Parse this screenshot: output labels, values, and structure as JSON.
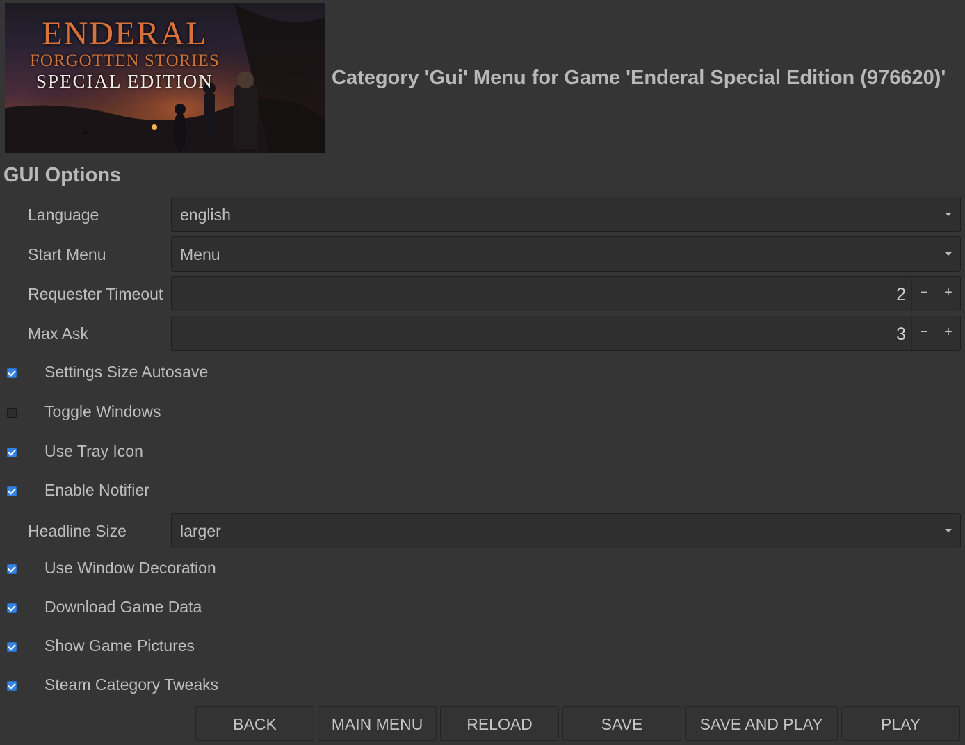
{
  "header": {
    "banner": {
      "title_line1": "ENDERAL",
      "title_line2": "FORGOTTEN STORIES",
      "title_line3": "SPECIAL EDITION"
    },
    "title": "Category 'Gui' Menu for Game 'Enderal Special Edition (976620)'"
  },
  "section_title": "GUI Options",
  "fields": {
    "language": {
      "label": "Language",
      "value": "english"
    },
    "start_menu": {
      "label": "Start Menu",
      "value": "Menu"
    },
    "requester_timeout": {
      "label": "Requester Timeout",
      "value": "2",
      "minus": "−",
      "plus": "+"
    },
    "max_ask": {
      "label": "Max Ask",
      "value": "3",
      "minus": "−",
      "plus": "+"
    },
    "headline_size": {
      "label": "Headline Size",
      "value": "larger"
    }
  },
  "checks": {
    "settings_size_autosave": {
      "label": "Settings Size Autosave",
      "checked": true
    },
    "toggle_windows": {
      "label": "Toggle Windows",
      "checked": false
    },
    "use_tray_icon": {
      "label": "Use Tray Icon",
      "checked": true
    },
    "enable_notifier": {
      "label": "Enable Notifier",
      "checked": true
    },
    "use_window_decoration": {
      "label": "Use Window Decoration",
      "checked": true
    },
    "download_game_data": {
      "label": "Download Game Data",
      "checked": true
    },
    "show_game_pictures": {
      "label": "Show Game Pictures",
      "checked": true
    },
    "steam_category_tweaks": {
      "label": "Steam Category Tweaks",
      "checked": true
    }
  },
  "buttons": {
    "back": "BACK",
    "main_menu": "MAIN MENU",
    "reload": "RELOAD",
    "save": "SAVE",
    "save_and_play": "SAVE AND PLAY",
    "play": "PLAY"
  },
  "colors": {
    "background": "#353535",
    "checkbox_accent": "#3584e4",
    "banner_title": "#d8713b"
  }
}
